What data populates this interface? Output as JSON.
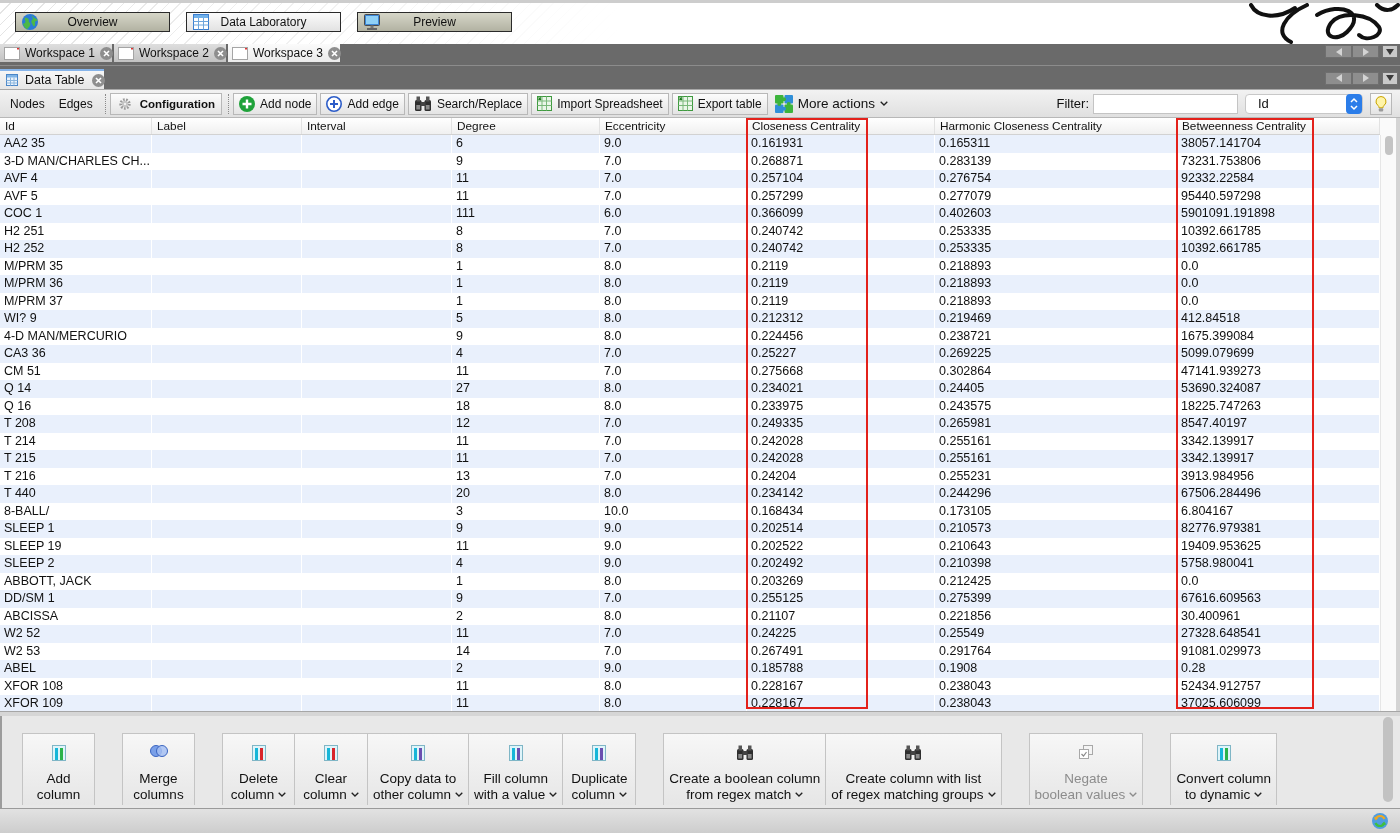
{
  "nav": [
    {
      "label": "Overview",
      "kind": "globe",
      "selected": false
    },
    {
      "label": "Data Laboratory",
      "kind": "table",
      "selected": true
    },
    {
      "label": "Preview",
      "kind": "monitor",
      "selected": false
    }
  ],
  "workspace_tabs": [
    {
      "label": "Workspace 1",
      "selected": false
    },
    {
      "label": "Workspace 2",
      "selected": false
    },
    {
      "label": "Workspace 3",
      "selected": true
    }
  ],
  "panel_tabs": [
    {
      "label": "Data Table",
      "selected": true
    }
  ],
  "toolbar": {
    "views": [
      "Nodes",
      "Edges"
    ],
    "configuration": "Configuration",
    "actions": [
      {
        "label": "Add node",
        "kind": "add"
      },
      {
        "label": "Add edge",
        "kind": "link"
      },
      {
        "label": "Search/Replace",
        "kind": "search"
      },
      {
        "label": "Import Spreadsheet",
        "kind": "sheet"
      },
      {
        "label": "Export table",
        "kind": "sheet"
      }
    ],
    "more_actions": "More actions",
    "filter_label": "Filter:",
    "filter_column": "Id"
  },
  "table": {
    "columns": [
      {
        "label": "Id",
        "highlighted": false
      },
      {
        "label": "Label",
        "highlighted": false
      },
      {
        "label": "Interval",
        "highlighted": false
      },
      {
        "label": "Degree",
        "highlighted": false
      },
      {
        "label": "Eccentricity",
        "highlighted": false
      },
      {
        "label": "Closeness Centrality",
        "highlighted": true
      },
      {
        "label": "Harmonic Closeness Centrality",
        "highlighted": false
      },
      {
        "label": "Betweenness Centrality",
        "highlighted": true
      }
    ],
    "rows": [
      {
        "id": "AA2 35",
        "degree": "6",
        "eccentricity": "9.0",
        "closeness_centrality": "0.161931",
        "harmonic_closeness_centrality": "0.165311",
        "betweenness_centrality": "38057.141704"
      },
      {
        "id": "3-D MAN/CHARLES CH...",
        "degree": "9",
        "eccentricity": "7.0",
        "closeness_centrality": "0.268871",
        "harmonic_closeness_centrality": "0.283139",
        "betweenness_centrality": "73231.753806"
      },
      {
        "id": "AVF 4",
        "degree": "11",
        "eccentricity": "7.0",
        "closeness_centrality": "0.257104",
        "harmonic_closeness_centrality": "0.276754",
        "betweenness_centrality": "92332.22584"
      },
      {
        "id": "AVF 5",
        "degree": "11",
        "eccentricity": "7.0",
        "closeness_centrality": "0.257299",
        "harmonic_closeness_centrality": "0.277079",
        "betweenness_centrality": "95440.597298"
      },
      {
        "id": "COC 1",
        "degree": "111",
        "eccentricity": "6.0",
        "closeness_centrality": "0.366099",
        "harmonic_closeness_centrality": "0.402603",
        "betweenness_centrality": "5901091.191898"
      },
      {
        "id": "H2 251",
        "degree": "8",
        "eccentricity": "7.0",
        "closeness_centrality": "0.240742",
        "harmonic_closeness_centrality": "0.253335",
        "betweenness_centrality": "10392.661785"
      },
      {
        "id": "H2 252",
        "degree": "8",
        "eccentricity": "7.0",
        "closeness_centrality": "0.240742",
        "harmonic_closeness_centrality": "0.253335",
        "betweenness_centrality": "10392.661785"
      },
      {
        "id": "M/PRM 35",
        "degree": "1",
        "eccentricity": "8.0",
        "closeness_centrality": "0.2119",
        "harmonic_closeness_centrality": "0.218893",
        "betweenness_centrality": "0.0"
      },
      {
        "id": "M/PRM 36",
        "degree": "1",
        "eccentricity": "8.0",
        "closeness_centrality": "0.2119",
        "harmonic_closeness_centrality": "0.218893",
        "betweenness_centrality": "0.0"
      },
      {
        "id": "M/PRM 37",
        "degree": "1",
        "eccentricity": "8.0",
        "closeness_centrality": "0.2119",
        "harmonic_closeness_centrality": "0.218893",
        "betweenness_centrality": "0.0"
      },
      {
        "id": "WI? 9",
        "degree": "5",
        "eccentricity": "8.0",
        "closeness_centrality": "0.212312",
        "harmonic_closeness_centrality": "0.219469",
        "betweenness_centrality": "412.84518"
      },
      {
        "id": "4-D MAN/MERCURIO",
        "degree": "9",
        "eccentricity": "8.0",
        "closeness_centrality": "0.224456",
        "harmonic_closeness_centrality": "0.238721",
        "betweenness_centrality": "1675.399084"
      },
      {
        "id": "CA3 36",
        "degree": "4",
        "eccentricity": "7.0",
        "closeness_centrality": "0.25227",
        "harmonic_closeness_centrality": "0.269225",
        "betweenness_centrality": "5099.079699"
      },
      {
        "id": "CM 51",
        "degree": "11",
        "eccentricity": "7.0",
        "closeness_centrality": "0.275668",
        "harmonic_closeness_centrality": "0.302864",
        "betweenness_centrality": "47141.939273"
      },
      {
        "id": "Q 14",
        "degree": "27",
        "eccentricity": "8.0",
        "closeness_centrality": "0.234021",
        "harmonic_closeness_centrality": "0.24405",
        "betweenness_centrality": "53690.324087"
      },
      {
        "id": "Q 16",
        "degree": "18",
        "eccentricity": "8.0",
        "closeness_centrality": "0.233975",
        "harmonic_closeness_centrality": "0.243575",
        "betweenness_centrality": "18225.747263"
      },
      {
        "id": "T 208",
        "degree": "12",
        "eccentricity": "7.0",
        "closeness_centrality": "0.249335",
        "harmonic_closeness_centrality": "0.265981",
        "betweenness_centrality": "8547.40197"
      },
      {
        "id": "T 214",
        "degree": "11",
        "eccentricity": "7.0",
        "closeness_centrality": "0.242028",
        "harmonic_closeness_centrality": "0.255161",
        "betweenness_centrality": "3342.139917"
      },
      {
        "id": "T 215",
        "degree": "11",
        "eccentricity": "7.0",
        "closeness_centrality": "0.242028",
        "harmonic_closeness_centrality": "0.255161",
        "betweenness_centrality": "3342.139917"
      },
      {
        "id": "T 216",
        "degree": "13",
        "eccentricity": "7.0",
        "closeness_centrality": "0.24204",
        "harmonic_closeness_centrality": "0.255231",
        "betweenness_centrality": "3913.984956"
      },
      {
        "id": "T 440",
        "degree": "20",
        "eccentricity": "8.0",
        "closeness_centrality": "0.234142",
        "harmonic_closeness_centrality": "0.244296",
        "betweenness_centrality": "67506.284496"
      },
      {
        "id": "8-BALL/",
        "degree": "3",
        "eccentricity": "10.0",
        "closeness_centrality": "0.168434",
        "harmonic_closeness_centrality": "0.173105",
        "betweenness_centrality": "6.804167"
      },
      {
        "id": "SLEEP 1",
        "degree": "9",
        "eccentricity": "9.0",
        "closeness_centrality": "0.202514",
        "harmonic_closeness_centrality": "0.210573",
        "betweenness_centrality": "82776.979381"
      },
      {
        "id": "SLEEP 19",
        "degree": "11",
        "eccentricity": "9.0",
        "closeness_centrality": "0.202522",
        "harmonic_closeness_centrality": "0.210643",
        "betweenness_centrality": "19409.953625"
      },
      {
        "id": "SLEEP 2",
        "degree": "4",
        "eccentricity": "9.0",
        "closeness_centrality": "0.202492",
        "harmonic_closeness_centrality": "0.210398",
        "betweenness_centrality": "5758.980041"
      },
      {
        "id": "ABBOTT, JACK",
        "degree": "1",
        "eccentricity": "8.0",
        "closeness_centrality": "0.203269",
        "harmonic_closeness_centrality": "0.212425",
        "betweenness_centrality": "0.0"
      },
      {
        "id": "DD/SM 1",
        "degree": "9",
        "eccentricity": "7.0",
        "closeness_centrality": "0.255125",
        "harmonic_closeness_centrality": "0.275399",
        "betweenness_centrality": "67616.609563"
      },
      {
        "id": "ABCISSA",
        "degree": "2",
        "eccentricity": "8.0",
        "closeness_centrality": "0.21107",
        "harmonic_closeness_centrality": "0.221856",
        "betweenness_centrality": "30.400961"
      },
      {
        "id": "W2 52",
        "degree": "11",
        "eccentricity": "7.0",
        "closeness_centrality": "0.24225",
        "harmonic_closeness_centrality": "0.25549",
        "betweenness_centrality": "27328.648541"
      },
      {
        "id": "W2 53",
        "degree": "14",
        "eccentricity": "7.0",
        "closeness_centrality": "0.267491",
        "harmonic_closeness_centrality": "0.291764",
        "betweenness_centrality": "91081.029973"
      },
      {
        "id": "ABEL",
        "degree": "2",
        "eccentricity": "9.0",
        "closeness_centrality": "0.185788",
        "harmonic_closeness_centrality": "0.1908",
        "betweenness_centrality": "0.28"
      },
      {
        "id": "XFOR 108",
        "degree": "11",
        "eccentricity": "8.0",
        "closeness_centrality": "0.228167",
        "harmonic_closeness_centrality": "0.238043",
        "betweenness_centrality": "52434.912757"
      },
      {
        "id": "XFOR 109",
        "degree": "11",
        "eccentricity": "8.0",
        "closeness_centrality": "0.228167",
        "harmonic_closeness_centrality": "0.238043",
        "betweenness_centrality": "37025.606099"
      }
    ]
  },
  "column_actions": [
    {
      "buttons": [
        {
          "lines": [
            "Add",
            "column"
          ],
          "kind": "add",
          "has_menu": false,
          "disabled": false
        }
      ]
    },
    {
      "buttons": [
        {
          "lines": [
            "Merge",
            "columns"
          ],
          "kind": "merge",
          "has_menu": false,
          "disabled": false
        }
      ]
    },
    {
      "buttons": [
        {
          "lines": [
            "Delete",
            "column"
          ],
          "kind": "remove",
          "has_menu": true,
          "disabled": false
        },
        {
          "lines": [
            "Clear",
            "column"
          ],
          "kind": "remove",
          "has_menu": true,
          "disabled": false
        },
        {
          "lines": [
            "Copy data to",
            "other column"
          ],
          "kind": "copy",
          "has_menu": true,
          "disabled": false
        },
        {
          "lines": [
            "Fill column",
            "with a value"
          ],
          "kind": "copy",
          "has_menu": true,
          "disabled": false
        },
        {
          "lines": [
            "Duplicate",
            "column"
          ],
          "kind": "copy",
          "has_menu": true,
          "disabled": false
        }
      ]
    },
    {
      "buttons": [
        {
          "lines": [
            "Create a boolean column",
            "from regex match"
          ],
          "kind": "search",
          "has_menu": true,
          "disabled": false
        },
        {
          "lines": [
            "Create column with list",
            "of regex matching groups"
          ],
          "kind": "search",
          "has_menu": true,
          "disabled": false
        }
      ]
    },
    {
      "buttons": [
        {
          "lines": [
            "Negate",
            "boolean values"
          ],
          "kind": "negate",
          "has_menu": true,
          "disabled": true
        }
      ]
    },
    {
      "buttons": [
        {
          "lines": [
            "Convert column",
            "to dynamic"
          ],
          "kind": "add",
          "has_menu": true,
          "disabled": false
        }
      ]
    }
  ]
}
